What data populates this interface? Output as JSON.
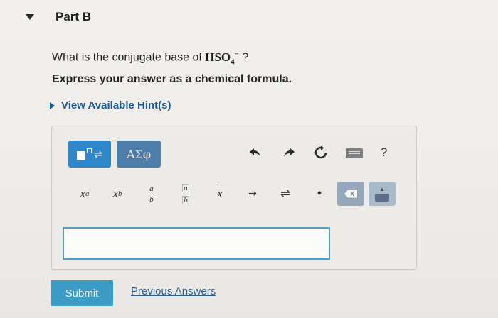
{
  "part": {
    "title": "Part B"
  },
  "question": {
    "text_before": "What is the conjugate base of ",
    "formula_main": "HSO",
    "formula_subscript": "4",
    "formula_charge": "−",
    "text_after": " ?"
  },
  "instruction": "Express your answer as a chemical formula.",
  "hint": {
    "label": "View Available Hint(s)"
  },
  "toolbar": {
    "templates_symbol": "⇌",
    "greek_label": "ΑΣφ",
    "undo_icon": "undo-icon",
    "redo_icon": "redo-icon",
    "reset_icon": "reset-icon",
    "keyboard_icon": "keyboard-icon",
    "help_label": "?",
    "accent_color": "#2f86c8"
  },
  "symbols": {
    "superscript_base": "x",
    "superscript_exp": "a",
    "subscript_base": "x",
    "subscript_idx": "b",
    "fraction_num": "a",
    "fraction_den": "b",
    "fraction_boxed_num": "a",
    "fraction_boxed_den": "b",
    "xbar": "x",
    "reaction_arrow": "→",
    "equilibrium_arrow": "⇌",
    "dot": "•",
    "delete_label": "X"
  },
  "answer": {
    "value": "",
    "placeholder": ""
  },
  "actions": {
    "submit_label": "Submit",
    "previous_answers_label": "Previous Answers"
  }
}
